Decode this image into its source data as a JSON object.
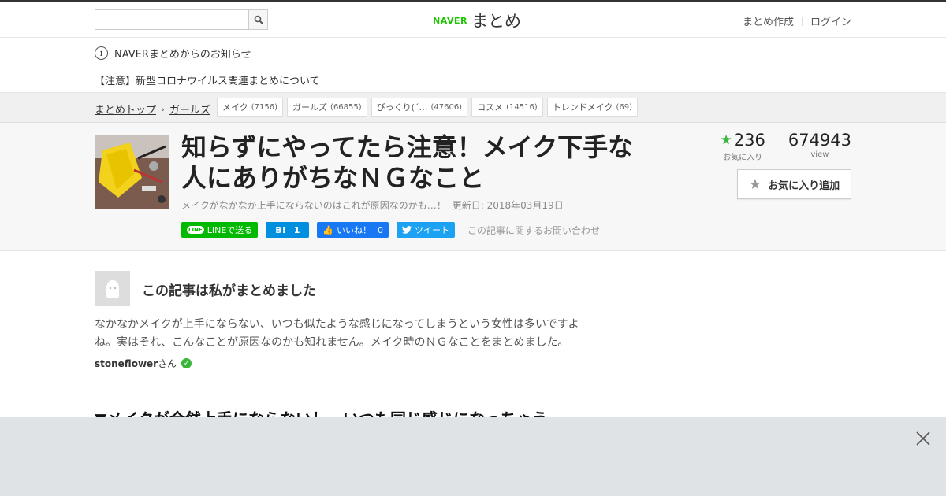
{
  "header": {
    "search_placeholder": "",
    "logo_brand": "NAVER",
    "logo_name": "まとめ",
    "links": [
      "まとめ作成",
      "ログイン"
    ]
  },
  "notice": {
    "title": "NAVERまとめからのお知らせ",
    "item": "【注意】新型コロナウイルス関連まとめについて"
  },
  "breadcrumb": {
    "items": [
      "まとめトップ",
      "ガールズ"
    ]
  },
  "tags": [
    {
      "label": "メイク",
      "count": "(7156)"
    },
    {
      "label": "ガールズ",
      "count": "(66855)"
    },
    {
      "label": "びっくり(´…",
      "count": "(47606)"
    },
    {
      "label": "コスメ",
      "count": "(14516)"
    },
    {
      "label": "トレンドメイク",
      "count": "(69)"
    }
  ],
  "article": {
    "title": "知らずにやってたら注意！メイク下手な人にありがちなＮＧなこと",
    "description": "メイクがなかなか上手にならないのはこれが原因なのかも…！",
    "updated": "更新日: 2018年03月19日",
    "favorites": "236",
    "favorites_label": "お気に入り",
    "views": "674943",
    "views_label": "view",
    "fav_button": "お気に入り追加"
  },
  "share": {
    "line": "LINEで送る",
    "hatena_count": "1",
    "fb_label": "いいね！",
    "fb_count": "0",
    "tweet": "ツイート",
    "inquiry": "この記事に関するお問い合わせ"
  },
  "author": {
    "heading": "この記事は私がまとめました",
    "text": "なかなかメイクが上手にならない、いつも似たような感じになってしまうという女性は多いですよね。実はそれ、こんなことが原因なのかも知れません。メイク時のＮＧなことをまとめました。",
    "name": "stoneflower",
    "suffix": "さん"
  },
  "section": {
    "heading": "▼メイクが全然上手にならないし、いつも同じ感じになっちゃう"
  },
  "colors": {
    "accent_green": "#1ec800",
    "line_green": "#00b900",
    "hatena_blue": "#008fde",
    "facebook_blue": "#1877f2",
    "twitter_blue": "#1da1f2"
  }
}
